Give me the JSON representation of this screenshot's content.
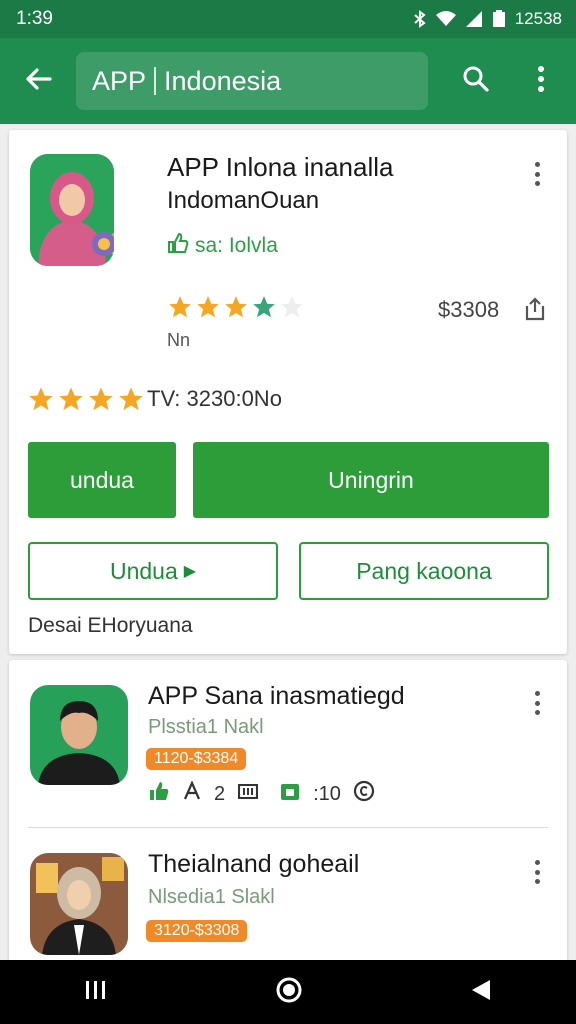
{
  "status_bar": {
    "time": "1:39",
    "right_text": "12538"
  },
  "app_bar": {
    "search_text_a": "APP",
    "search_text_b": "Indonesia"
  },
  "featured": {
    "title_line1": "APP Inlona inanalla",
    "title_line2": "IndomanOuan",
    "tag": "sa: Iolvla",
    "rating_stars": 3.5,
    "price": "$3308",
    "under_rating": "Nn",
    "rating2_stars": 4,
    "rating2_text": "TV: 3230:0No",
    "btn_primary_1": "undua",
    "btn_primary_2": "Uningrin",
    "btn_outline_1": "Undua",
    "btn_outline_2": "Pang kaoona",
    "footer": "Desai EHoryuana"
  },
  "list": [
    {
      "title": "APP Sana inasmatiegd",
      "subtitle": "Plsstia1 Nakl",
      "badge": "1120-$3384",
      "meta_a": "2",
      "meta_b": ":10"
    },
    {
      "title": "Theialnand goheail",
      "subtitle": "Nlsedia1 Slakl",
      "badge": "3120-$3308"
    }
  ],
  "colors": {
    "primary": "#1f8c50",
    "status": "#1b7a45",
    "button": "#2d9d3a",
    "badge": "#f08a28",
    "star": "#f5a623"
  }
}
